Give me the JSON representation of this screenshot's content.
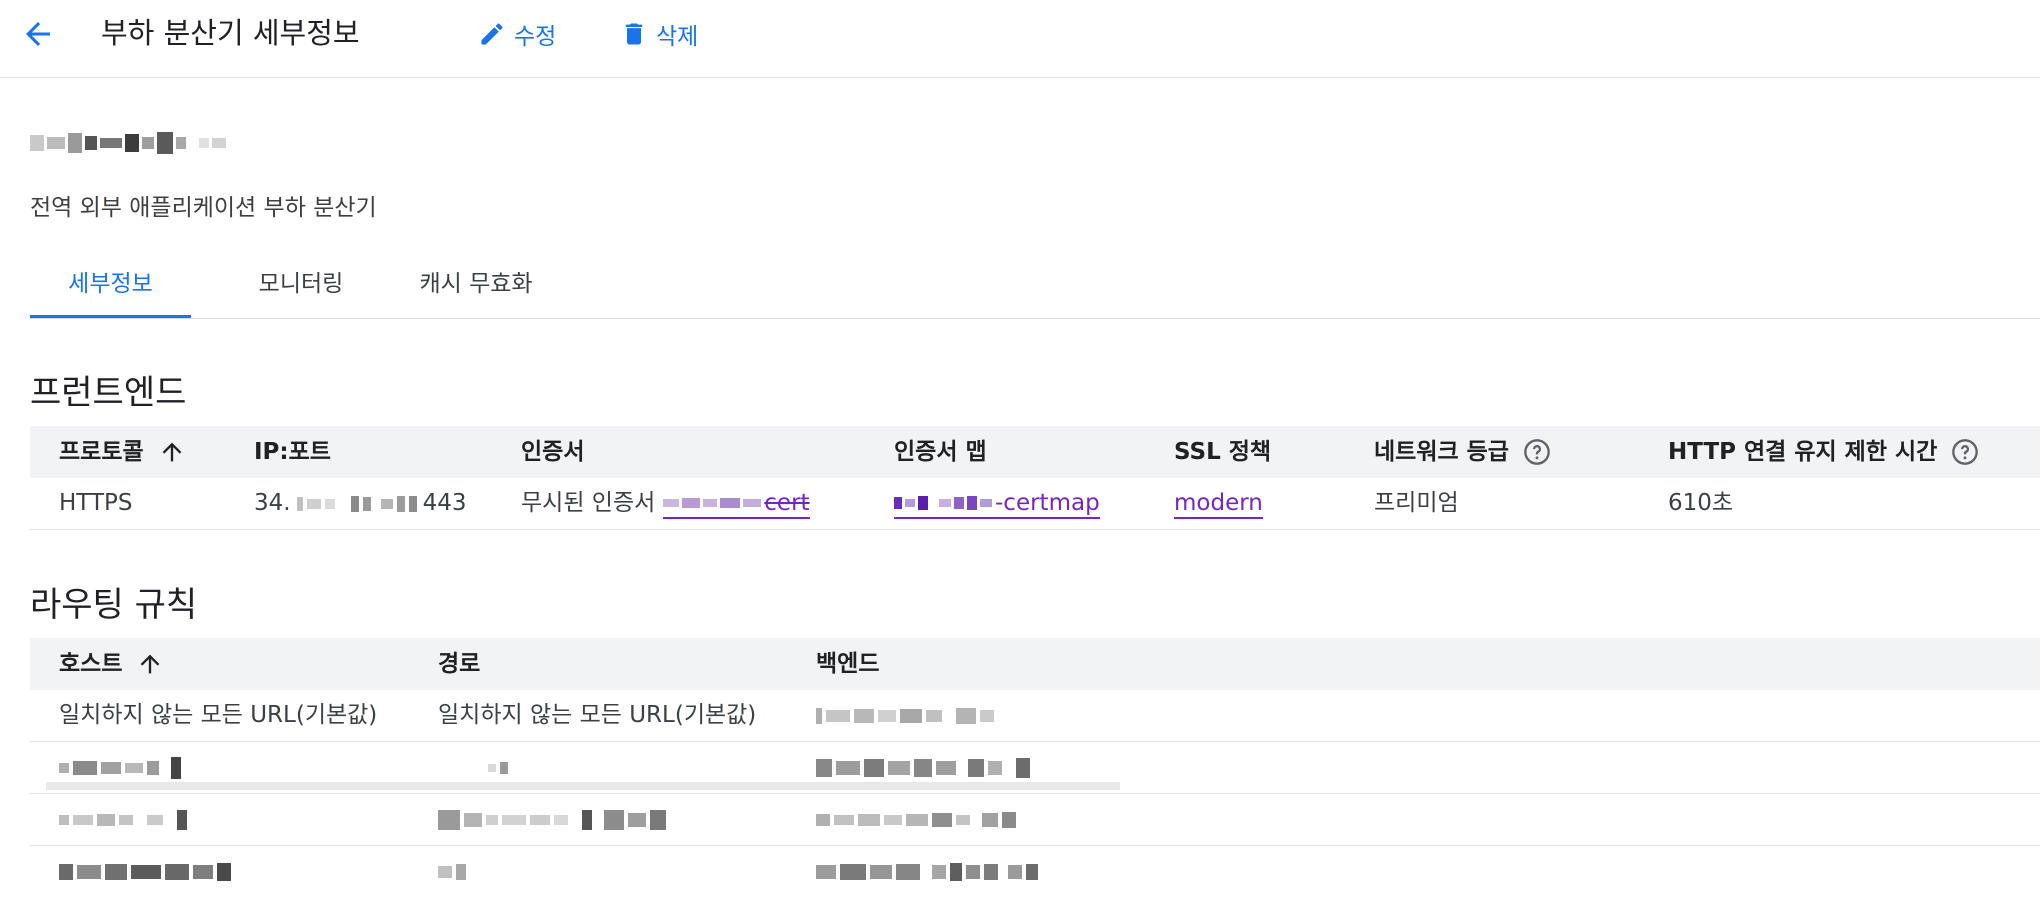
{
  "header": {
    "title": "부하 분산기 세부정보",
    "edit_label": "수정",
    "delete_label": "삭제"
  },
  "load_balancer": {
    "type": "전역 외부 애플리케이션 부하 분산기"
  },
  "tabs": [
    {
      "label": "세부정보",
      "active": true
    },
    {
      "label": "모니터링",
      "active": false
    },
    {
      "label": "캐시 무효화",
      "active": false
    }
  ],
  "frontend": {
    "title": "프런트엔드",
    "columns": [
      "프로토콜",
      "IP:포트",
      "인증서",
      "인증서 맵",
      "SSL 정책",
      "네트워크 등급",
      "HTTP 연결 유지 제한 시간"
    ],
    "rows": [
      {
        "protocol": "HTTPS",
        "ip_prefix": "34.",
        "ip_suffix": "443",
        "cert_prefix": "무시된 인증서",
        "cert_suffix": "cert",
        "certmap_suffix": "-certmap",
        "ssl_policy": "modern",
        "network_tier": "프리미엄",
        "keepalive": "610초"
      }
    ]
  },
  "routing": {
    "title": "라우팅 규칙",
    "columns": [
      "호스트",
      "경로",
      "백엔드"
    ],
    "rows": [
      {
        "host": "일치하지 않는 모든 URL(기본값)",
        "path": "일치하지 않는 모든 URL(기본값)"
      }
    ]
  },
  "colors": {
    "accent": "#1a73e8",
    "link": "#7627bb",
    "header_bg": "#f1f3f4"
  },
  "icons": [
    "arrow-back-icon",
    "pencil-icon",
    "trash-icon",
    "arrow-up-icon",
    "help-circle-icon"
  ]
}
